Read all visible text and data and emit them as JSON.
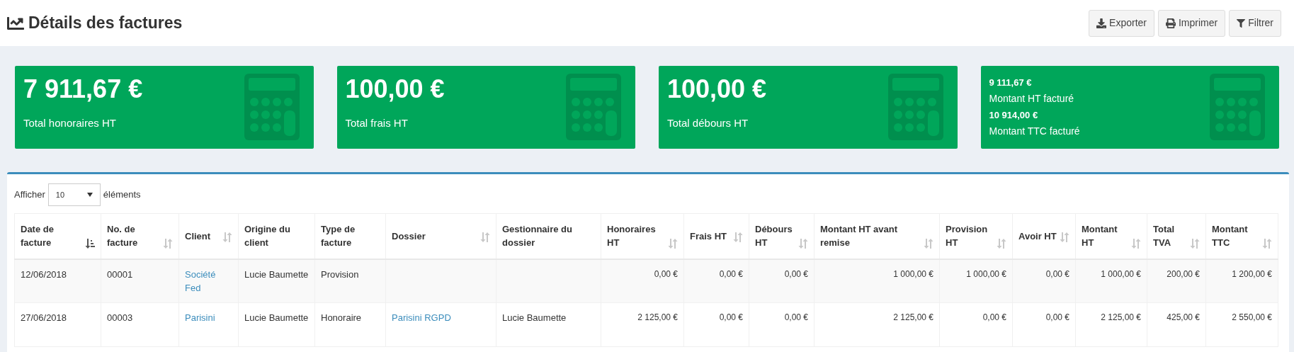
{
  "page": {
    "title": "Détails des factures"
  },
  "toolbar": [
    {
      "kind": "export",
      "label": "Exporter"
    },
    {
      "kind": "print",
      "label": "Imprimer"
    },
    {
      "kind": "filter",
      "label": "Filtrer"
    }
  ],
  "stats": [
    {
      "kind": "single",
      "value": "7 911,67 €",
      "label": "Total honoraires HT"
    },
    {
      "kind": "single",
      "value": "100,00 €",
      "label": "Total frais HT"
    },
    {
      "kind": "single",
      "value": "100,00 €",
      "label": "Total débours HT"
    },
    {
      "kind": "double",
      "lines": [
        {
          "value": "9 111,67 €",
          "label": "Montant HT facturé"
        },
        {
          "value": "10 914,00 €",
          "label": "Montant TTC facturé"
        }
      ]
    }
  ],
  "table_controls": {
    "before": "Afficher",
    "page_size": "10",
    "after": "éléments"
  },
  "table": {
    "columns": [
      {
        "label": "Date de facture",
        "kind": "text",
        "sortable": true,
        "sorted": true
      },
      {
        "label": "No. de facture",
        "kind": "text",
        "sortable": true,
        "sorted": false
      },
      {
        "label": "Client",
        "kind": "text",
        "sortable": true,
        "sorted": false
      },
      {
        "label": "Origine du client",
        "kind": "text",
        "sortable": false
      },
      {
        "label": "Type de facture",
        "kind": "text",
        "sortable": false
      },
      {
        "label": "Dossier",
        "kind": "text",
        "sortable": true,
        "sorted": false
      },
      {
        "label": "Gestionnaire du dossier",
        "kind": "text",
        "sortable": false
      },
      {
        "label": "Honoraires HT",
        "kind": "amount",
        "sortable": true,
        "sorted": false
      },
      {
        "label": "Frais HT",
        "kind": "amount",
        "sortable": true,
        "sorted": false
      },
      {
        "label": "Débours HT",
        "kind": "amount",
        "sortable": true,
        "sorted": false
      },
      {
        "label": "Montant HT avant remise",
        "kind": "amount",
        "sortable": true,
        "sorted": false
      },
      {
        "label": "Provision HT",
        "kind": "amount",
        "sortable": true,
        "sorted": false
      },
      {
        "label": "Avoir HT",
        "kind": "amount",
        "sortable": true,
        "sorted": false
      },
      {
        "label": "Montant HT",
        "kind": "amount",
        "sortable": true,
        "sorted": false
      },
      {
        "label": "Total TVA",
        "kind": "amount",
        "sortable": true,
        "sorted": false
      },
      {
        "label": "Montant TTC",
        "kind": "amount",
        "sortable": true,
        "sorted": false
      }
    ],
    "rows": [
      {
        "cells": [
          {
            "text": "12/06/2018",
            "link": false
          },
          {
            "text": "00001",
            "link": false
          },
          {
            "text": "Société Fed",
            "link": true
          },
          {
            "text": "Lucie Baumette",
            "link": false
          },
          {
            "text": "Provision",
            "link": false
          },
          null,
          null,
          {
            "text": "0,00 €",
            "link": false
          },
          {
            "text": "0,00 €",
            "link": false
          },
          {
            "text": "0,00 €",
            "link": false
          },
          {
            "text": "1 000,00 €",
            "link": false
          },
          {
            "text": "1 000,00 €",
            "link": false
          },
          {
            "text": "0,00 €",
            "link": false
          },
          {
            "text": "1 000,00 €",
            "link": false
          },
          {
            "text": "200,00 €",
            "link": false
          },
          {
            "text": "1 200,00 €",
            "link": false
          }
        ]
      },
      {
        "cells": [
          {
            "text": "27/06/2018",
            "link": false
          },
          {
            "text": "00003",
            "link": false
          },
          {
            "text": "Parisini",
            "link": true
          },
          {
            "text": "Lucie Baumette",
            "link": false
          },
          {
            "text": "Honoraire",
            "link": false
          },
          {
            "text": "Parisini RGPD",
            "link": true
          },
          {
            "text": "Lucie Baumette",
            "link": false
          },
          {
            "text": "2 125,00 €",
            "link": false
          },
          {
            "text": "0,00 €",
            "link": false
          },
          {
            "text": "0,00 €",
            "link": false
          },
          {
            "text": "2 125,00 €",
            "link": false
          },
          {
            "text": "0,00 €",
            "link": false
          },
          {
            "text": "0,00 €",
            "link": false
          },
          {
            "text": "2 125,00 €",
            "link": false
          },
          {
            "text": "425,00 €",
            "link": false
          },
          {
            "text": "2 550,00 €",
            "link": false
          }
        ]
      }
    ]
  }
}
